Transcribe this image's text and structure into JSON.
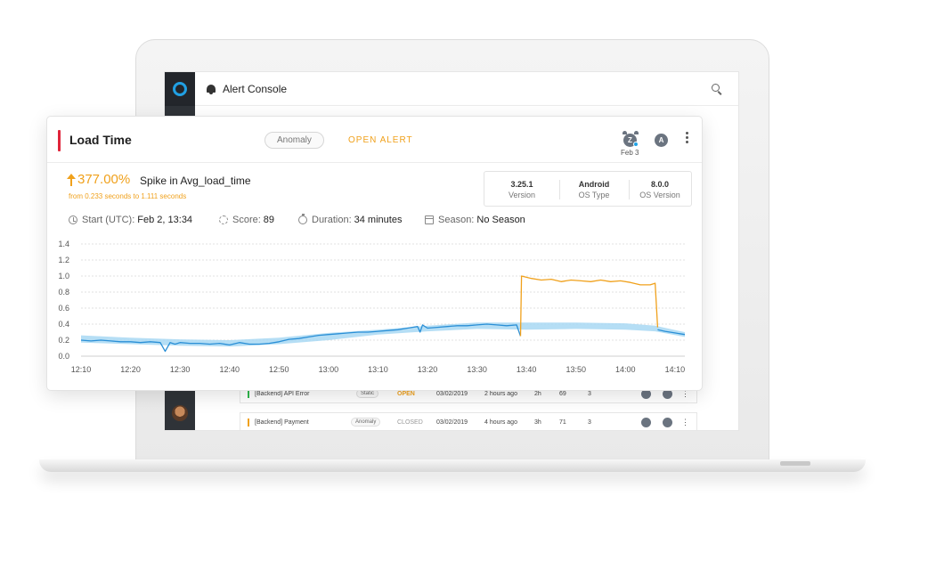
{
  "app": {
    "title": "Alert Console",
    "search_icon": "search-icon"
  },
  "background_rows": [
    {
      "mark_color": "#2eb84b",
      "name": "[Backend] API Error",
      "type": "Static",
      "status": "OPEN",
      "status_color": "#f0a11c",
      "date": "03/02/2019",
      "age": "2 hours ago",
      "duration": "2h",
      "score": "69",
      "count": "3"
    },
    {
      "mark_color": "#f0a11c",
      "name": "[Backend] Payment",
      "type": "Anomaly",
      "status": "CLOSED",
      "status_color": "#999999",
      "date": "03/02/2019",
      "age": "4 hours ago",
      "duration": "3h",
      "score": "71",
      "count": "3"
    }
  ],
  "alert": {
    "title": "Load Time",
    "type": "Anomaly",
    "status": "OPEN ALERT",
    "snooze_date": "Feb 3",
    "snooze_letter": "Z",
    "assignee_letter": "A",
    "change_pct": "377.00%",
    "change_desc": "Spike in Avg_load_time",
    "change_range": "from 0.233 seconds to 1.111 seconds",
    "properties": [
      {
        "value": "3.25.1",
        "key": "Version"
      },
      {
        "value": "Android",
        "key": "OS Type"
      },
      {
        "value": "8.0.0",
        "key": "OS Version"
      }
    ],
    "start_label": "Start (UTC):",
    "start_value": "Feb 2, 13:34",
    "score_label": "Score:",
    "score_value": "89",
    "duration_label": "Duration:",
    "duration_value": "34 minutes",
    "season_label": "Season:",
    "season_value": "No Season"
  },
  "chart_data": {
    "type": "line",
    "x_ticks": [
      "12:10",
      "12:20",
      "12:30",
      "12:40",
      "12:50",
      "13:00",
      "13:10",
      "13:20",
      "13:30",
      "13:40",
      "13:50",
      "14:00",
      "14:10"
    ],
    "y_ticks": [
      "0.0",
      "0.2",
      "0.4",
      "0.6",
      "0.8",
      "1.0",
      "1.2",
      "1.4"
    ],
    "ylim": [
      0,
      1.4
    ],
    "x_range_minutes": [
      0,
      122
    ],
    "grid": true,
    "colors": {
      "normal": "#2a8fd6",
      "anomaly": "#f0a11c",
      "baseline_band": "#a8d8f3"
    },
    "series": [
      {
        "role": "metric",
        "x": [
          0,
          2,
          4,
          6,
          8,
          10,
          12,
          14,
          16,
          17,
          18,
          19,
          20,
          22,
          24,
          26,
          28,
          30,
          32,
          34,
          36,
          38,
          40,
          42,
          44,
          46,
          48,
          50,
          52,
          54,
          56,
          58,
          60,
          62,
          64,
          66,
          68,
          68.5,
          69,
          70,
          72,
          74,
          76,
          78,
          80,
          82,
          84,
          86,
          88,
          88.8
        ],
        "y": [
          0.2,
          0.19,
          0.2,
          0.19,
          0.18,
          0.18,
          0.17,
          0.18,
          0.17,
          0.06,
          0.17,
          0.15,
          0.17,
          0.16,
          0.16,
          0.15,
          0.16,
          0.14,
          0.17,
          0.15,
          0.15,
          0.16,
          0.18,
          0.21,
          0.22,
          0.24,
          0.26,
          0.27,
          0.28,
          0.29,
          0.3,
          0.3,
          0.31,
          0.32,
          0.33,
          0.35,
          0.37,
          0.3,
          0.39,
          0.35,
          0.36,
          0.37,
          0.38,
          0.38,
          0.39,
          0.4,
          0.39,
          0.38,
          0.39,
          0.25
        ]
      },
      {
        "role": "anomaly",
        "x": [
          88.8,
          89,
          91,
          93,
          95,
          97,
          99,
          101,
          103,
          105,
          107,
          109,
          111,
          113,
          115,
          116,
          116.5
        ],
        "y": [
          0.25,
          1.0,
          0.97,
          0.95,
          0.96,
          0.93,
          0.95,
          0.94,
          0.93,
          0.95,
          0.93,
          0.94,
          0.92,
          0.89,
          0.89,
          0.91,
          0.36
        ]
      },
      {
        "role": "metric",
        "x": [
          116.5,
          118,
          120,
          122
        ],
        "y": [
          0.33,
          0.31,
          0.29,
          0.27
        ]
      }
    ],
    "baseline_band": {
      "x": [
        0,
        10,
        20,
        30,
        40,
        50,
        60,
        70,
        80,
        90,
        100,
        110,
        116,
        122
      ],
      "lower": [
        0.17,
        0.15,
        0.13,
        0.12,
        0.15,
        0.2,
        0.27,
        0.31,
        0.34,
        0.33,
        0.34,
        0.33,
        0.31,
        0.24
      ],
      "upper": [
        0.26,
        0.23,
        0.21,
        0.2,
        0.23,
        0.29,
        0.33,
        0.38,
        0.42,
        0.42,
        0.42,
        0.41,
        0.38,
        0.3
      ]
    }
  }
}
